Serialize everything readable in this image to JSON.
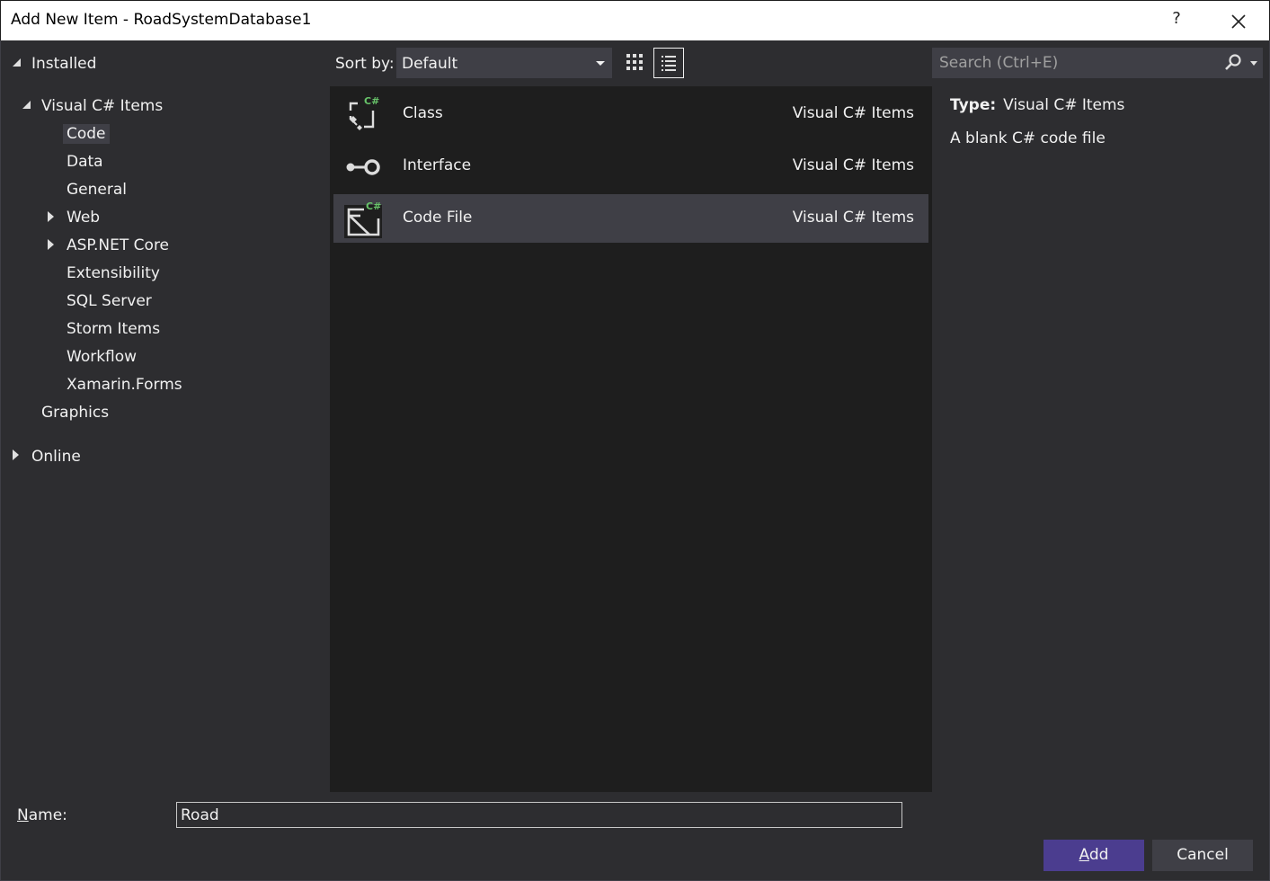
{
  "window": {
    "title": "Add New Item - RoadSystemDatabase1",
    "help_label": "?"
  },
  "tree": {
    "installed": "Installed",
    "visual_csharp_items": "Visual C# Items",
    "children": [
      "Code",
      "Data",
      "General",
      "Web",
      "ASP.NET Core",
      "Extensibility",
      "SQL Server",
      "Storm Items",
      "Workflow",
      "Xamarin.Forms"
    ],
    "graphics": "Graphics",
    "online": "Online",
    "selected": "Code"
  },
  "toolbar": {
    "sort_label": "Sort by:",
    "sort_value": "Default",
    "search_placeholder": "Search (Ctrl+E)"
  },
  "items": [
    {
      "name": "Class",
      "category": "Visual C# Items",
      "icon": "class-icon"
    },
    {
      "name": "Interface",
      "category": "Visual C# Items",
      "icon": "interface-icon"
    },
    {
      "name": "Code File",
      "category": "Visual C# Items",
      "icon": "code-file-icon",
      "selected": true
    }
  ],
  "description": {
    "type_label": "Type:",
    "type_value": "Visual C# Items",
    "text": "A blank C# code file"
  },
  "footer": {
    "name_label_underlined": "N",
    "name_label_rest": "ame:",
    "name_value": "Road",
    "add_underlined": "A",
    "add_rest": "dd",
    "cancel_label": "Cancel"
  },
  "colors": {
    "accent": "#4b3d8f",
    "csharp_badge": "#68c46a"
  }
}
